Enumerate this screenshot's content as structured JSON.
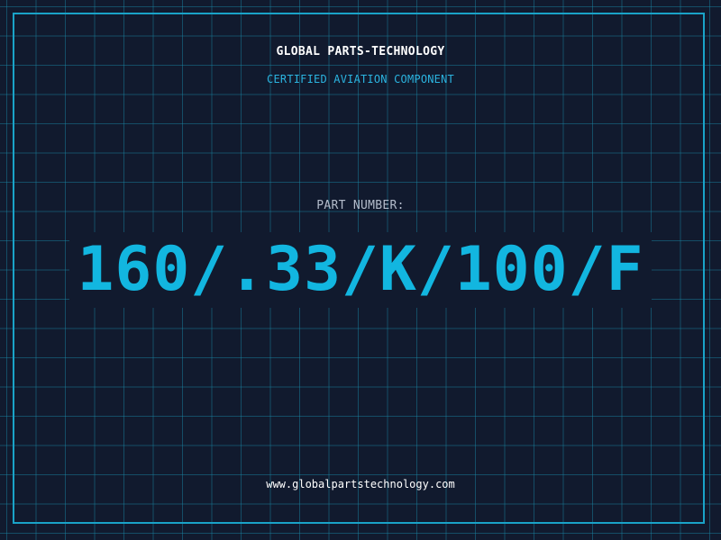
{
  "header": {
    "company": "GLOBAL PARTS-TECHNOLOGY",
    "subtitle": "CERTIFIED AVIATION COMPONENT"
  },
  "part": {
    "label": "PART NUMBER:",
    "number": "160/.33/K/100/F"
  },
  "footer": {
    "url": "www.globalpartstechnology.com"
  },
  "colors": {
    "background": "#111a2e",
    "grid": "#1a8caa",
    "frame": "#1aa3c8",
    "accent": "#12b6e0",
    "subtitle": "#2bb4e0"
  }
}
